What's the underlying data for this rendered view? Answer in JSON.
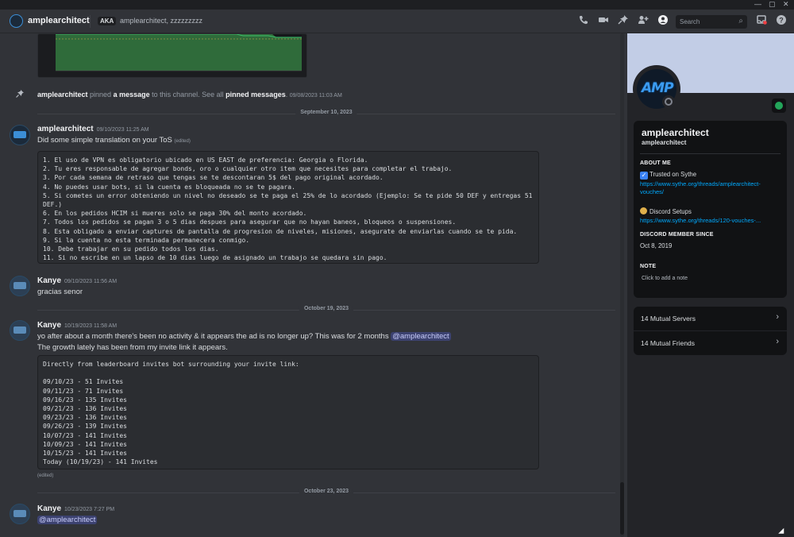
{
  "window": {
    "min_label": "—",
    "max_label": "▢",
    "close_label": "✕"
  },
  "header": {
    "name": "amplearchitect",
    "aka_label": "AKA",
    "aka_value": "amplearchitect, zzzzzzzzz",
    "search_placeholder": "Search",
    "icons": [
      "call-icon",
      "video-icon",
      "pin-icon",
      "add-friend-icon",
      "profile-icon",
      "inbox-icon",
      "help-icon"
    ]
  },
  "system_message": {
    "user": "amplearchitect",
    "text_1": " pinned ",
    "link_1": "a message",
    "text_2": " to this channel. See all ",
    "link_2": "pinned messages",
    "text_3": ".",
    "time": "09/08/2023 11:03 AM"
  },
  "dividers": [
    "September 10, 2023",
    "October 19, 2023",
    "October 23, 2023"
  ],
  "messages": [
    {
      "author": "amplearchitect",
      "time": "09/10/2023 11:25 AM",
      "text": "Did some simple translation on your ToS",
      "edited": "(edited)",
      "code": [
        "1. El uso de VPN es obligatorio ubicado en US EAST de preferencia: Georgia o Florida.",
        "2. Tu eres responsable de agregar bonds, oro o cualquier otro item que necesites para completar el trabajo.",
        "3. Por cada semana de retraso que tengas se te descontaran 5$ del pago original acordado.",
        "4. No puedes usar bots, si la cuenta es bloqueada no se te pagara.",
        "5. Si cometes un error obteniendo un nivel no deseado se te paga el 25% de lo acordado (Ejemplo: Se te pide 50 DEF y entregas 51 DEF.)",
        "6. En los pedidos HCIM si mueres solo se paga 30% del monto acordado.",
        "7. Todos los pedidos se pagan 3 o 5 dias despues para asegurar que no hayan baneos, bloqueos o suspensiones.",
        "8. Esta obligado a enviar captures de pantalla de progresion de niveles, misiones, asegurate de enviarlas cuando se te pida.",
        "9. Si la cuenta no esta terminada permanecera conmigo.",
        "10. Debe trabajar en su pedido todos los dias.",
        "11. Si no escribe en un lapso de 10 dias luego de asignado un trabajo se quedara sin pago."
      ]
    },
    {
      "author": "Kanye",
      "time": "09/10/2023 11:56 AM",
      "text": "gracias senor"
    },
    {
      "author": "Kanye",
      "time": "10/19/2023 11:58 AM",
      "text": "yo after about a month there's been no activity & it appears the ad is no longer up? This was for 2 months ",
      "mention": "@amplearchitect",
      "text2": "The growth lately has been from my invite link it appears.",
      "code": [
        "Directly from leaderboard invites bot surrounding your invite link:",
        "",
        "09/10/23 - 51 Invites",
        "09/11/23 - 71 Invites",
        "09/16/23 - 135 Invites",
        "09/21/23 - 136 Invites",
        "09/23/23 - 136 Invites",
        "09/26/23 - 139 Invites",
        "10/07/23 - 141 Invites",
        "10/09/23 - 141 Invites",
        "10/15/23 - 141 Invites",
        "Today (10/19/23) - 141 Invites"
      ],
      "edited": "(edited)"
    },
    {
      "author": "Kanye",
      "time": "10/23/2023 7:27 PM",
      "mention": "@amplearchitect"
    }
  ],
  "profile": {
    "display_name": "amplearchitect",
    "username": "amplearchitect",
    "avatar_text": "AMP",
    "about_title": "ABOUT ME",
    "about_line1": "Trusted on Sythe",
    "about_link1": "https://www.sythe.org/threads/amplearchitect-vouches/",
    "about_line2": "Discord Setups",
    "about_link2": "https://www.sythe.org/threads/120-vouches-...",
    "member_since_title": "DISCORD MEMBER SINCE",
    "member_since": "Oct 8, 2019",
    "note_title": "NOTE",
    "note_placeholder": "Click to add a note",
    "mutual_servers": "14 Mutual Servers",
    "mutual_friends": "14 Mutual Friends"
  }
}
